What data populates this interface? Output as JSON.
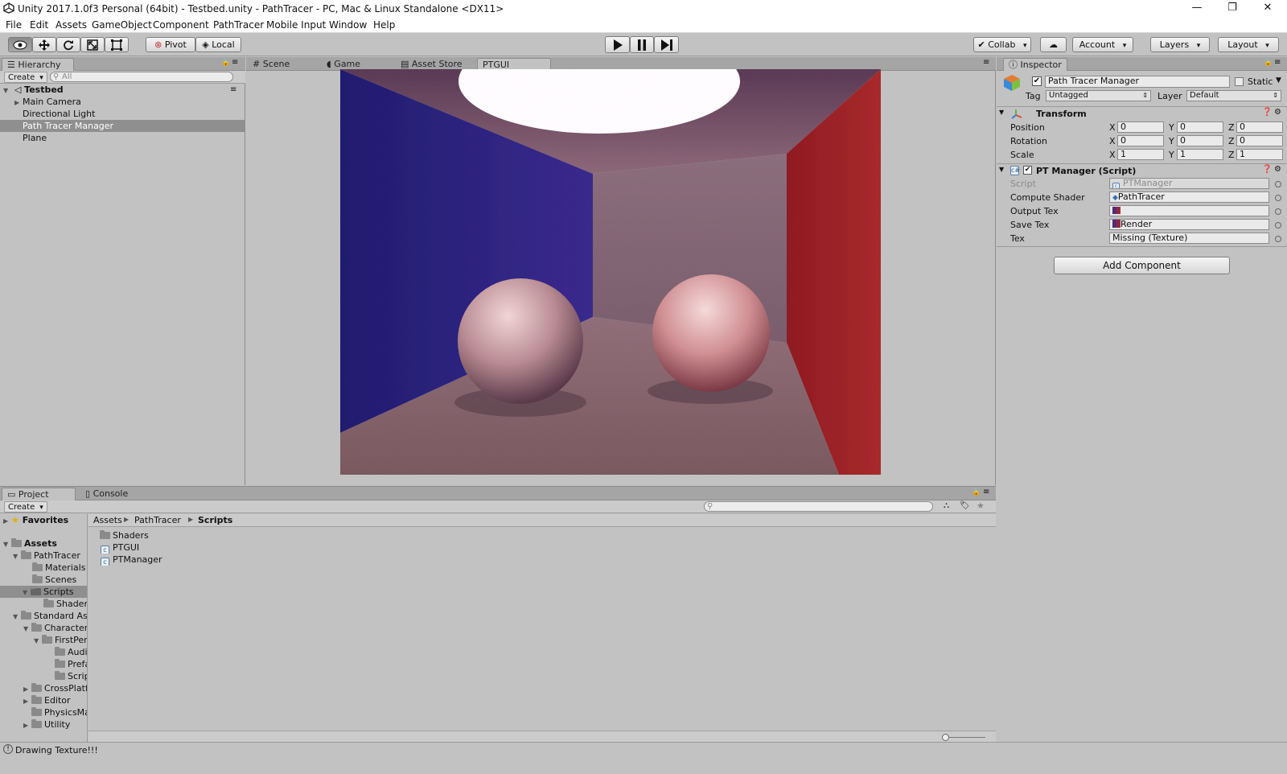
{
  "window": {
    "title": "Unity 2017.1.0f3 Personal (64bit) - Testbed.unity - PathTracer - PC, Mac & Linux Standalone <DX11>",
    "controls": {
      "minimize": "—",
      "restore": "❐",
      "close": "✕"
    }
  },
  "menu": [
    "File",
    "Edit",
    "Assets",
    "GameObject",
    "Component",
    "PathTracer",
    "Mobile Input",
    "Window",
    "Help"
  ],
  "toolbar": {
    "pivot_label": "Pivot",
    "local_label": "Local",
    "collab_label": "Collab",
    "account_label": "Account",
    "layers_label": "Layers",
    "layout_label": "Layout"
  },
  "hierarchy": {
    "tab": "Hierarchy",
    "create": "Create",
    "search_placeholder": "All",
    "scene": "Testbed",
    "items": [
      "Main Camera",
      "Directional Light",
      "Path Tracer Manager",
      "Plane"
    ]
  },
  "center_tabs": [
    "Scene",
    "Game",
    "Asset Store",
    "PTGUI"
  ],
  "inspector": {
    "tab": "Inspector",
    "object_name": "Path Tracer Manager",
    "static_label": "Static",
    "tag_label": "Tag",
    "tag_value": "Untagged",
    "layer_label": "Layer",
    "layer_value": "Default",
    "transform": {
      "title": "Transform",
      "rows": [
        {
          "label": "Position",
          "x": "0",
          "y": "0",
          "z": "0"
        },
        {
          "label": "Rotation",
          "x": "0",
          "y": "0",
          "z": "0"
        },
        {
          "label": "Scale",
          "x": "1",
          "y": "1",
          "z": "1"
        }
      ],
      "axis_x": "X",
      "axis_y": "Y",
      "axis_z": "Z"
    },
    "script_component": {
      "title": "PT Manager (Script)",
      "rows": [
        {
          "label": "Script",
          "value": "PTManager"
        },
        {
          "label": "Compute Shader",
          "value": "PathTracer"
        },
        {
          "label": "Output Tex",
          "value": ""
        },
        {
          "label": "Save Tex",
          "value": "Render"
        },
        {
          "label": "Tex",
          "value": "Missing (Texture)"
        }
      ]
    },
    "add_component": "Add Component"
  },
  "project": {
    "tabs": [
      "Project",
      "Console"
    ],
    "create": "Create",
    "tree": [
      {
        "label": "Favorites",
        "depth": 0
      },
      {
        "label": "Assets",
        "depth": 0
      },
      {
        "label": "PathTracer",
        "depth": 1
      },
      {
        "label": "Materials",
        "depth": 2
      },
      {
        "label": "Scenes",
        "depth": 2
      },
      {
        "label": "Scripts",
        "depth": 2
      },
      {
        "label": "Shaders",
        "depth": 3
      },
      {
        "label": "Standard Assets",
        "depth": 1
      },
      {
        "label": "Characters",
        "depth": 2
      },
      {
        "label": "FirstPersonCharacter",
        "depth": 3
      },
      {
        "label": "Audio",
        "depth": 4
      },
      {
        "label": "Prefabs",
        "depth": 4
      },
      {
        "label": "Scripts",
        "depth": 4
      },
      {
        "label": "CrossPlatformInput",
        "depth": 2
      },
      {
        "label": "Editor",
        "depth": 2
      },
      {
        "label": "PhysicsMaterials",
        "depth": 2
      },
      {
        "label": "Utility",
        "depth": 2
      }
    ],
    "breadcrumb": [
      "Assets",
      "PathTracer",
      "Scripts"
    ],
    "files": [
      {
        "name": "Shaders",
        "type": "folder"
      },
      {
        "name": "PTGUI",
        "type": "script"
      },
      {
        "name": "PTManager",
        "type": "script"
      }
    ]
  },
  "status": {
    "message": "Drawing Texture!!!"
  },
  "colors": {
    "panel": "#c2c2c2",
    "tabbar": "#a5a5a5",
    "selection": "#8f8f8f",
    "wall_left": "#2a2585",
    "wall_right": "#9b1d1f"
  }
}
